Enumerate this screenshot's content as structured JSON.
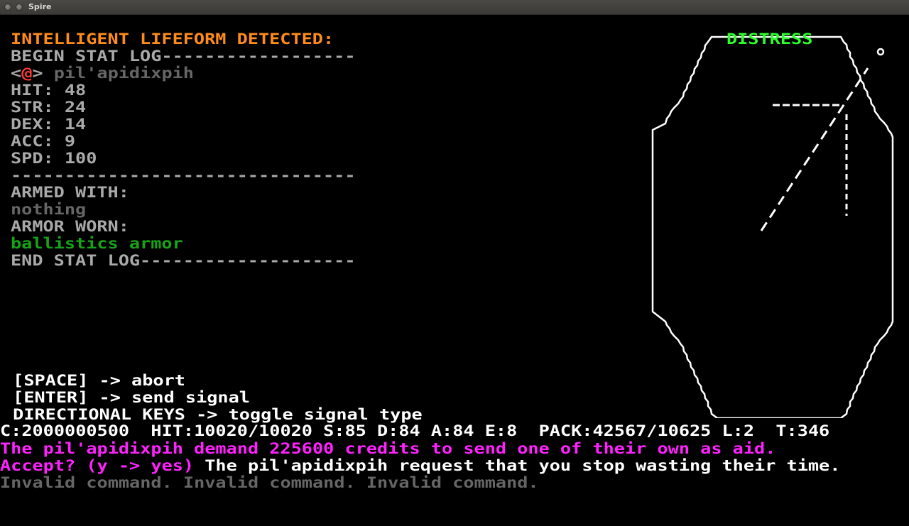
{
  "window": {
    "title": "Spire"
  },
  "stat_log": {
    "header": "INTELLIGENT LIFEFORM DETECTED:",
    "begin": "BEGIN STAT LOG------------------",
    "glyph_open": "<",
    "glyph": "@",
    "glyph_close": ">",
    "species": " pil'apidixpih",
    "stats": [
      "HIT: 48",
      "STR: 24",
      "DEX: 14",
      "ACC: 9",
      "SPD: 100"
    ],
    "divider": "--------------------------------",
    "armed_label": "ARMED WITH:",
    "armed_value": "nothing",
    "armor_label": "ARMOR WORN:",
    "armor_value": "ballistics armor",
    "end": "END STAT LOG--------------------"
  },
  "radar": {
    "label": "DISTRESS",
    "marker": "o",
    "colors": {
      "outline": "#ffffff",
      "label": "#2cff2c"
    }
  },
  "controls": [
    " [SPACE] -> abort",
    " [ENTER] -> send signal",
    " DIRECTIONAL KEYS -> toggle signal type"
  ],
  "status_bar": "C:2000000500  HIT:10020/10020 S:85 D:84 A:84 E:8  PACK:42567/10625 L:2  T:346",
  "messages": {
    "line1": "The pil'apidixpih demand 225600 credits to send one of their own as aid.",
    "line2_prompt": "Accept? (y -> yes)",
    "line2_rest": " The pil'apidixpih request that you stop wasting their time.",
    "line3": "Invalid command. Invalid command. Invalid command."
  },
  "colors": {
    "header": "#ff8c1a",
    "stat_text": "#a9a9a9",
    "dim_text": "#666666",
    "armor": "#16a316",
    "message": "#ff22ff",
    "glyph": "#ff3a3a",
    "background": "#000000"
  }
}
